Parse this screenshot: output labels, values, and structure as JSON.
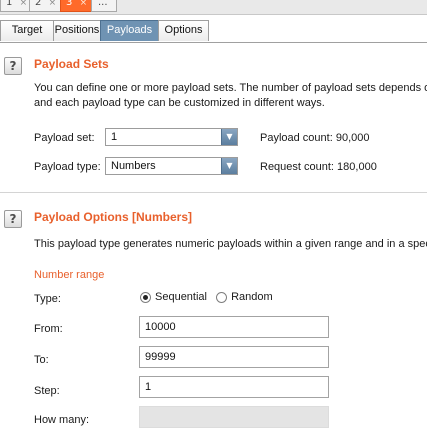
{
  "attack_tabs": [
    {
      "label": "1",
      "close": "×"
    },
    {
      "label": "2",
      "close": "×"
    },
    {
      "label": "3",
      "close": "×"
    },
    {
      "label": "..."
    }
  ],
  "sub_tabs": [
    "Target",
    "Positions",
    "Payloads",
    "Options"
  ],
  "payload_sets": {
    "title": "Payload Sets",
    "help": "?",
    "description_line1": "You can define one or more payload sets. The number of payload sets depends o",
    "description_line2": "and each payload type can be customized in different ways.",
    "set_label": "Payload set:",
    "set_value": "1",
    "type_label": "Payload type:",
    "type_value": "Numbers",
    "payload_count": "Payload count: 90,000",
    "request_count": "Request count: 180,000"
  },
  "payload_options": {
    "title": "Payload Options [Numbers]",
    "help": "?",
    "description": "This payload type generates numeric payloads within a given range and in a speci",
    "range_heading": "Number range",
    "type_label": "Type:",
    "type_options": [
      "Sequential",
      "Random"
    ],
    "type_selected": "Sequential",
    "from_label": "From:",
    "from_value": "10000",
    "to_label": "To:",
    "to_value": "99999",
    "step_label": "Step:",
    "step_value": "1",
    "how_many_label": "How many:",
    "how_many_value": ""
  }
}
